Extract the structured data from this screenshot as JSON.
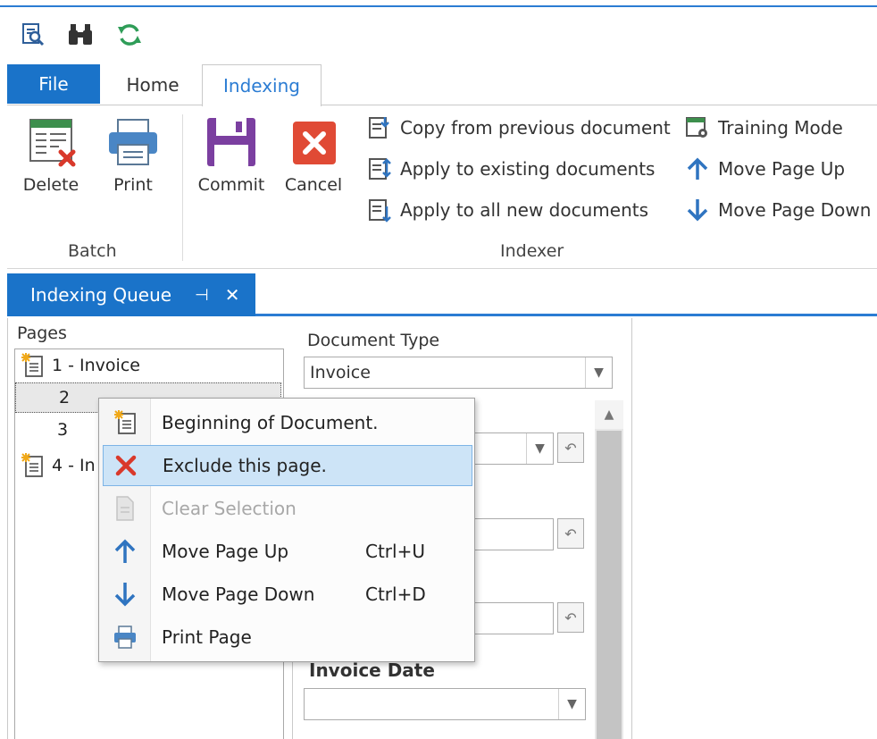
{
  "tabs": {
    "file": "File",
    "home": "Home",
    "indexing": "Indexing"
  },
  "ribbon": {
    "batch": {
      "group_label": "Batch",
      "delete": "Delete",
      "print": "Print"
    },
    "indexer": {
      "group_label": "Indexer",
      "commit": "Commit",
      "cancel": "Cancel",
      "copy_previous": "Copy from previous document",
      "apply_existing": "Apply to existing documents",
      "apply_new": "Apply to all new documents",
      "training_mode": "Training Mode",
      "move_page_up": "Move Page Up",
      "move_page_down": "Move Page Down"
    }
  },
  "doc_tab": {
    "title": "Indexing Queue",
    "pin": "⊣",
    "close": "✕"
  },
  "pages": {
    "label": "Pages",
    "items": [
      {
        "label": "1 - Invoice"
      },
      {
        "label": "2"
      },
      {
        "label": "3"
      },
      {
        "label": "4 - In"
      }
    ]
  },
  "form": {
    "document_type_label": "Document Type",
    "document_type_value": "Invoice",
    "invoice_date_label": "Invoice Date",
    "invoice_date_value": ""
  },
  "context_menu": {
    "items": [
      {
        "label": "Beginning of Document.",
        "shortcut": "",
        "icon": "new-document-icon"
      },
      {
        "label": "Exclude this page.",
        "shortcut": "",
        "icon": "red-x-icon"
      },
      {
        "label": "Clear Selection",
        "shortcut": "",
        "icon": "blank-page-icon"
      },
      {
        "label": "Move Page Up",
        "shortcut": "Ctrl+U",
        "icon": "arrow-up-icon"
      },
      {
        "label": "Move Page Down",
        "shortcut": "Ctrl+D",
        "icon": "arrow-down-icon"
      },
      {
        "label": "Print Page",
        "shortcut": "",
        "icon": "printer-icon"
      }
    ]
  },
  "colors": {
    "accent": "#1a73c9",
    "highlight": "#cde4f7",
    "delete_red": "#d9392b",
    "commit_purple": "#7b3fa0",
    "arrow_blue": "#2f74c0"
  }
}
